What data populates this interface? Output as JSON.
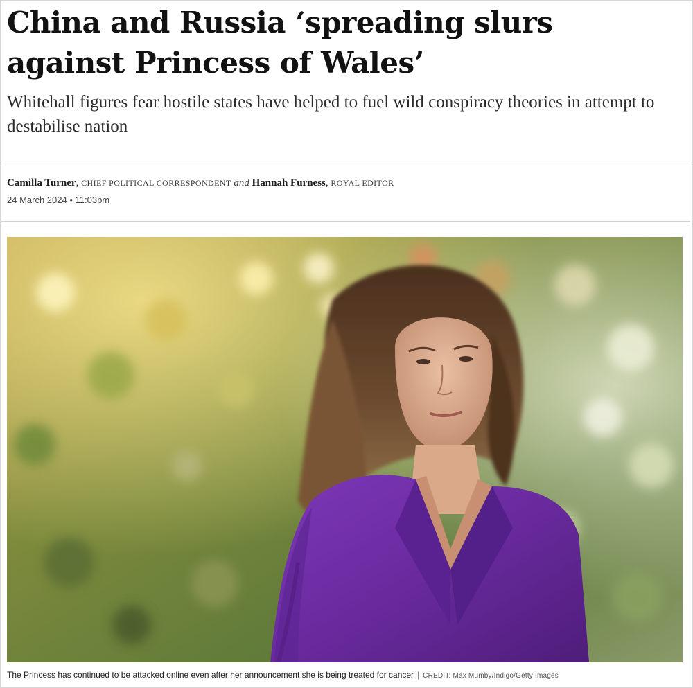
{
  "article": {
    "headline": "China and Russia ‘spreading slurs against Princess of Wales’",
    "standfirst": "Whitehall figures fear hostile states have helped to fuel wild conspiracy theories in attempt to destabilise nation",
    "byline": {
      "author1": "Camilla Turner",
      "role1": "CHIEF POLITICAL CORRESPONDENT",
      "conjunction": "and",
      "author2": "Hannah Furness",
      "role2": "ROYAL EDITOR"
    },
    "date": "24 March 2024 • 11:03pm"
  },
  "image": {
    "caption": "The Princess has continued to be attacked online even after her announcement she is being treated for cancer",
    "separator": "|",
    "credit": "CREDIT: Max Mumby/Indigo/Getty Images"
  },
  "colors": {
    "suit": "#6a2a9e",
    "background_foliage": "#7d8a3e"
  }
}
